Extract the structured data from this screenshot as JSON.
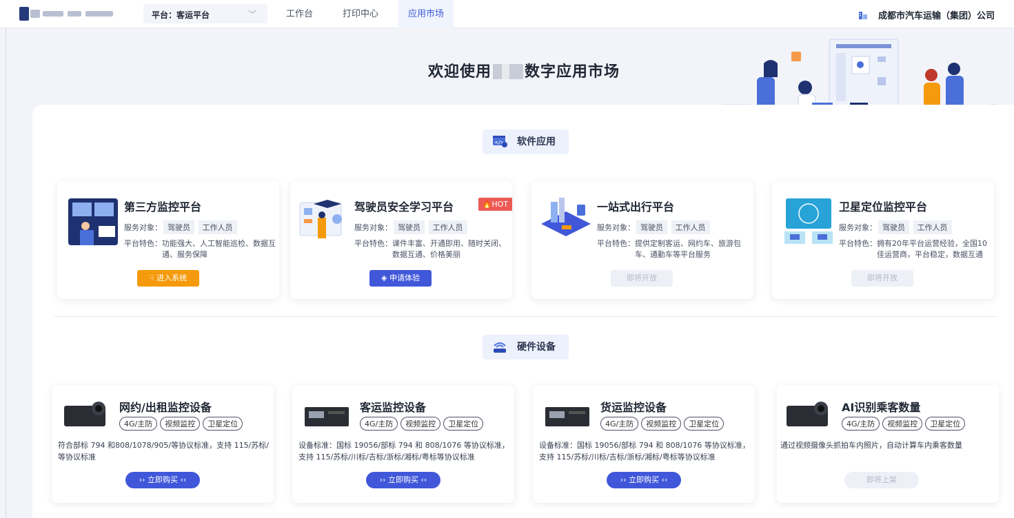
{
  "header": {
    "platform_label": "平台：客运平台",
    "nav": [
      "工作台",
      "打印中心",
      "应用市场"
    ],
    "org_name": "成都市汽车运输（集团）公司"
  },
  "hero": {
    "title_prefix": "欢迎使用",
    "title_suffix": "数字应用市场"
  },
  "software": {
    "section_label": "软件应用",
    "cards": [
      {
        "title": "第三方监控平台",
        "service_prefix": "服务对象：",
        "tags": [
          "驾驶员",
          "工作人员"
        ],
        "feature_prefix": "平台特色：",
        "feature_l1": "功能强大、人工智能巡检、数据互",
        "feature_l2": "通、服务保障",
        "button": "进入系统",
        "button_icon": "hand-point-icon"
      },
      {
        "title": "驾驶员安全学习平台",
        "badge": "HOT",
        "service_prefix": "服务对象：",
        "tags": [
          "驾驶员",
          "工作人员"
        ],
        "feature_prefix": "平台特色：",
        "feature_l1": "课件丰富、开通即用、随时关闭、",
        "feature_l2": "数据互通、价格美丽",
        "button": "申请体验",
        "button_icon": "tag-icon"
      },
      {
        "title": "一站式出行平台",
        "service_prefix": "服务对象：",
        "tags": [
          "驾驶员",
          "工作人员"
        ],
        "feature_prefix": "平台特色：",
        "feature_l1": "提供定制客运、网约车、旅游包",
        "feature_l2": "车、通勤车等平台服务",
        "button": "即将开放"
      },
      {
        "title": "卫星定位监控平台",
        "service_prefix": "服务对象：",
        "tags": [
          "驾驶员",
          "工作人员"
        ],
        "feature_prefix": "平台特色：",
        "feature_l1": "拥有20年平台运营经验，全国10",
        "feature_l2": "佳运营商，平台稳定，数据互通",
        "button": "即将开放"
      }
    ]
  },
  "hardware": {
    "section_label": "硬件设备",
    "cards": [
      {
        "title": "网约/出租监控设备",
        "pills": [
          "4G/主防",
          "视频监控",
          "卫星定位"
        ],
        "desc_l1": "符合部标 794 和808/1078/905/等协议标准，支持 115/苏标/",
        "desc_l2": "等协议标准",
        "button": "立即购买"
      },
      {
        "title": "客运监控设备",
        "pills": [
          "4G/主防",
          "视频监控",
          "卫星定位"
        ],
        "desc_l1": "设备标准：国标 19056/部标 794 和 808/1076 等协议标准，",
        "desc_l2": "支持 115/苏标/川标/吉标/浙标/湘标/粤标等协议标准",
        "button": "立即购买"
      },
      {
        "title": "货运监控设备",
        "pills": [
          "4G/主防",
          "视频监控",
          "卫星定位"
        ],
        "desc_l1": "设备标准：国标 19056/部标 794 和 808/1076 等协议标准，",
        "desc_l2": "支持 115/苏标/川标/吉标/浙标/湘标/粤标等协议标准",
        "button": "立即购买"
      },
      {
        "title": "AI识别乘客数量",
        "pills": [
          "4G/主防",
          "视频监控",
          "卫星定位"
        ],
        "desc_l1": "通过视频摄像头抓拍车内照片，自动计算车内乘客数量",
        "desc_l2": "",
        "button": "即将上架"
      }
    ]
  },
  "colors": {
    "accent": "#4157d9",
    "orange": "#f59a0c",
    "hot": "#ec5a55"
  }
}
